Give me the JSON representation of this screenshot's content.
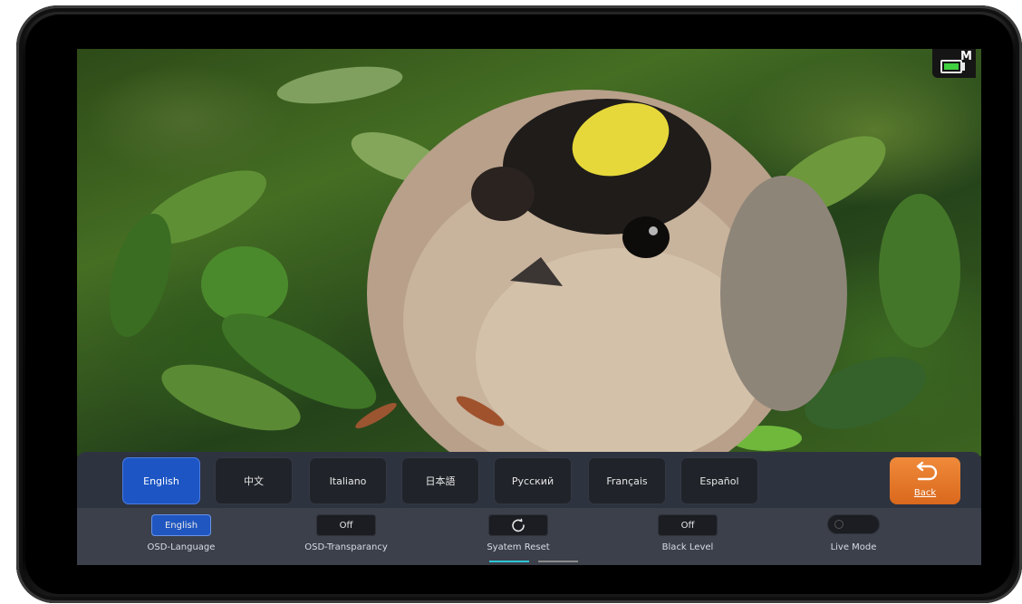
{
  "status": {
    "battery_icon": "battery-icon",
    "battery_mode": "M",
    "battery_fill_color": "#3fd13f"
  },
  "languages": [
    {
      "label": "English",
      "selected": true
    },
    {
      "label": "中文",
      "selected": false
    },
    {
      "label": "Italiano",
      "selected": false
    },
    {
      "label": "日本語",
      "selected": false
    },
    {
      "label": "Русский",
      "selected": false
    },
    {
      "label": "Français",
      "selected": false
    },
    {
      "label": "Español",
      "selected": false
    }
  ],
  "back_button": {
    "label": "Back",
    "icon": "return-arrow-icon",
    "color": "#e8772a"
  },
  "settings": [
    {
      "value": "English",
      "caption": "OSD-Language"
    },
    {
      "value": "Off",
      "caption": "OSD-Transparancy"
    },
    {
      "value": "",
      "icon": "reset-icon",
      "caption": "Syatem Reset"
    },
    {
      "value": "Off",
      "caption": "Black Level"
    },
    {
      "value": "",
      "caption": "Live Mode",
      "toggle_state": "off"
    }
  ],
  "page_indicator": {
    "pages": 2,
    "current": 1,
    "active_color": "#2ec6d6",
    "inactive_color": "#8a8a8a"
  },
  "accent_color": "#1d55c4"
}
